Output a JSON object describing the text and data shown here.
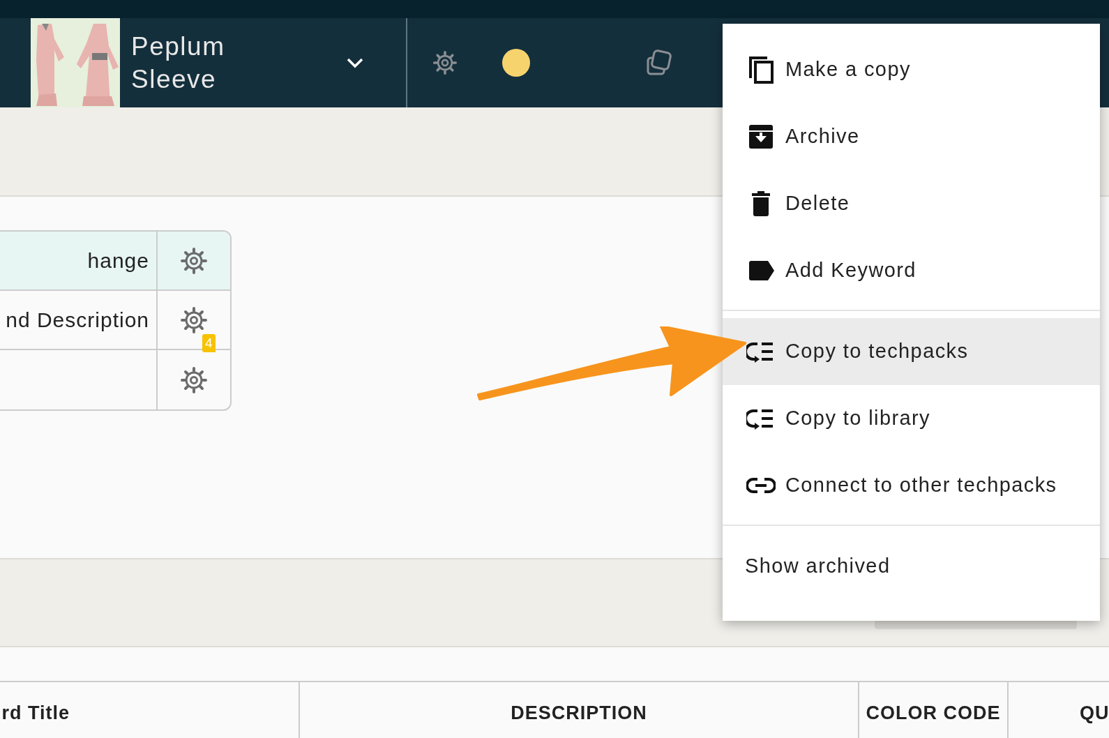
{
  "header": {
    "title": "Peplum Sleeve"
  },
  "side_table": {
    "rows": [
      {
        "text": "hange",
        "selected": true,
        "comments": null
      },
      {
        "text": "nd Description",
        "selected": false,
        "comments": "4"
      },
      {
        "text": "",
        "selected": false,
        "comments": null
      }
    ]
  },
  "materials_table": {
    "columns": [
      "rd Title",
      "DESCRIPTION",
      "COLOR CODE",
      "QU"
    ]
  },
  "menu": {
    "groups": [
      {
        "items": [
          {
            "label": "Make a copy",
            "kind": "copy",
            "selected": false
          },
          {
            "label": "Archive",
            "kind": "archive",
            "selected": false
          },
          {
            "label": "Delete",
            "kind": "delete",
            "selected": false
          },
          {
            "label": "Add Keyword",
            "kind": "keyword",
            "selected": false
          }
        ]
      },
      {
        "items": [
          {
            "label": "Copy to techpacks",
            "kind": "copy-list",
            "selected": true
          },
          {
            "label": "Copy to library",
            "kind": "copy-list",
            "selected": false
          },
          {
            "label": "Connect to other techpacks",
            "kind": "link",
            "selected": false
          }
        ]
      },
      {
        "items": [
          {
            "label": "Show archived",
            "kind": "plain",
            "selected": false
          }
        ]
      }
    ]
  }
}
